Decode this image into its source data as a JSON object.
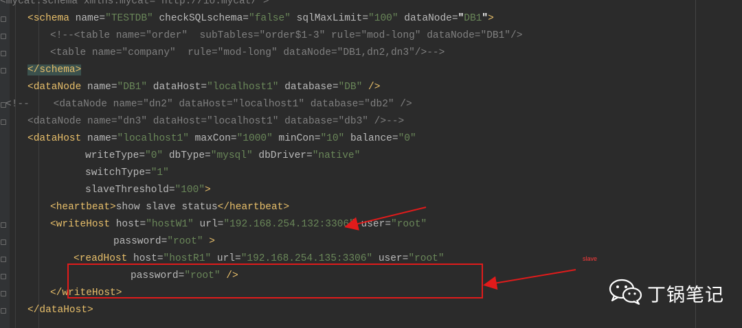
{
  "editor": {
    "lines": [
      {
        "indent": 0,
        "segments": [
          {
            "t": "c",
            "x": "<mycat:schema xmlns:mycat=\"http://io.mycat/\">"
          }
        ]
      },
      {
        "indent": 40,
        "segments": [
          {
            "t": "t",
            "x": "<schema"
          },
          {
            "t": "a",
            "x": " name="
          },
          {
            "t": "v",
            "x": "\"TESTDB\""
          },
          {
            "t": "a",
            "x": " checkSQLschema="
          },
          {
            "t": "v",
            "x": "\"false\""
          },
          {
            "t": "a",
            "x": " sqlMaxLimit="
          },
          {
            "t": "v",
            "x": "\"100\""
          },
          {
            "t": "a",
            "x": " dataNode="
          },
          {
            "t": "q",
            "x": "\""
          },
          {
            "t": "v",
            "x": "DB1"
          },
          {
            "t": "q",
            "x": "\""
          },
          {
            "t": "t",
            "x": ">"
          }
        ]
      },
      {
        "indent": 73,
        "segments": [
          {
            "t": "c",
            "x": "<!--<table name=\"order\"  subTables=\"order$1-3\" rule=\"mod-long\" dataNode=\"DB1\"/>"
          }
        ]
      },
      {
        "indent": 73,
        "segments": [
          {
            "t": "c",
            "x": "<table name=\"company\"  rule=\"mod-long\" dataNode=\"DB1,dn2,dn3\"/>-->"
          }
        ]
      },
      {
        "indent": 40,
        "segments": [
          {
            "t": "t",
            "x": "</schema>",
            "h": true
          }
        ]
      },
      {
        "indent": 40,
        "segments": [
          {
            "t": "t",
            "x": "<dataNode"
          },
          {
            "t": "a",
            "x": " name="
          },
          {
            "t": "v",
            "x": "\"DB1\""
          },
          {
            "t": "a",
            "x": " dataHost="
          },
          {
            "t": "v",
            "x": "\"localhost1\""
          },
          {
            "t": "a",
            "x": " database="
          },
          {
            "t": "v",
            "x": "\"DB\""
          },
          {
            "t": "t",
            "x": " />"
          }
        ]
      },
      {
        "indent": 8,
        "segments": [
          {
            "t": "c",
            "x": "<!--    <dataNode name=\"dn2\" dataHost=\"localhost1\" database=\"db2\" />"
          }
        ]
      },
      {
        "indent": 40,
        "segments": [
          {
            "t": "c",
            "x": "<dataNode name=\"dn3\" dataHost=\"localhost1\" database=\"db3\" />-->"
          }
        ]
      },
      {
        "indent": 40,
        "segments": [
          {
            "t": "t",
            "x": "<dataHost"
          },
          {
            "t": "a",
            "x": " name="
          },
          {
            "t": "v",
            "x": "\"localhost1\""
          },
          {
            "t": "a",
            "x": " maxCon="
          },
          {
            "t": "v",
            "x": "\"1000\""
          },
          {
            "t": "a",
            "x": " minCon="
          },
          {
            "t": "v",
            "x": "\"10\""
          },
          {
            "t": "a",
            "x": " balance="
          },
          {
            "t": "v",
            "x": "\"0\""
          }
        ]
      },
      {
        "indent": 124,
        "segments": [
          {
            "t": "a",
            "x": "writeType="
          },
          {
            "t": "v",
            "x": "\"0\""
          },
          {
            "t": "a",
            "x": " dbType="
          },
          {
            "t": "v",
            "x": "\"mysql\""
          },
          {
            "t": "a",
            "x": " dbDriver="
          },
          {
            "t": "v",
            "x": "\"native\""
          }
        ]
      },
      {
        "indent": 124,
        "segments": [
          {
            "t": "a",
            "x": "switchType="
          },
          {
            "t": "v",
            "x": "\"1\""
          }
        ]
      },
      {
        "indent": 124,
        "segments": [
          {
            "t": "a",
            "x": "slaveThreshold="
          },
          {
            "t": "v",
            "x": "\"100\""
          },
          {
            "t": "t",
            "x": ">"
          }
        ]
      },
      {
        "indent": 73,
        "segments": [
          {
            "t": "t",
            "x": "<heartbeat>"
          },
          {
            "t": "a",
            "x": "show slave status"
          },
          {
            "t": "t",
            "x": "</heartbeat>"
          }
        ]
      },
      {
        "indent": 73,
        "segments": [
          {
            "t": "t",
            "x": "<writeHost"
          },
          {
            "t": "a",
            "x": " host="
          },
          {
            "t": "v",
            "x": "\"hostW1\""
          },
          {
            "t": "a",
            "x": " url="
          },
          {
            "t": "v",
            "x": "\"192.168.254.132:3306\""
          },
          {
            "t": "a",
            "x": " user="
          },
          {
            "t": "v",
            "x": "\"root\""
          }
        ]
      },
      {
        "indent": 165,
        "segments": [
          {
            "t": "a",
            "x": "password="
          },
          {
            "t": "v",
            "x": "\"root\""
          },
          {
            "t": "t",
            "x": " >"
          }
        ]
      },
      {
        "indent": 107,
        "segments": [
          {
            "t": "t",
            "x": "<readHost"
          },
          {
            "t": "a",
            "x": " host="
          },
          {
            "t": "v",
            "x": "\"hostR1\""
          },
          {
            "t": "a",
            "x": " url="
          },
          {
            "t": "v",
            "x": "\"192.168.254.135:3306\""
          },
          {
            "t": "a",
            "x": " user="
          },
          {
            "t": "v",
            "x": "\"root\""
          }
        ]
      },
      {
        "indent": 190,
        "segments": [
          {
            "t": "a",
            "x": "password="
          },
          {
            "t": "v",
            "x": "\"root\""
          },
          {
            "t": "t",
            "x": " />"
          }
        ]
      },
      {
        "indent": 73,
        "segments": [
          {
            "t": "t",
            "x": "</writeHost>"
          }
        ]
      },
      {
        "indent": 40,
        "segments": [
          {
            "t": "t",
            "x": "</dataHost>"
          }
        ]
      }
    ]
  },
  "annotation": {
    "label": "slave",
    "color": "#e11b1b"
  },
  "watermark": {
    "text": "丁锅笔记",
    "icon": "wechat-icon"
  }
}
